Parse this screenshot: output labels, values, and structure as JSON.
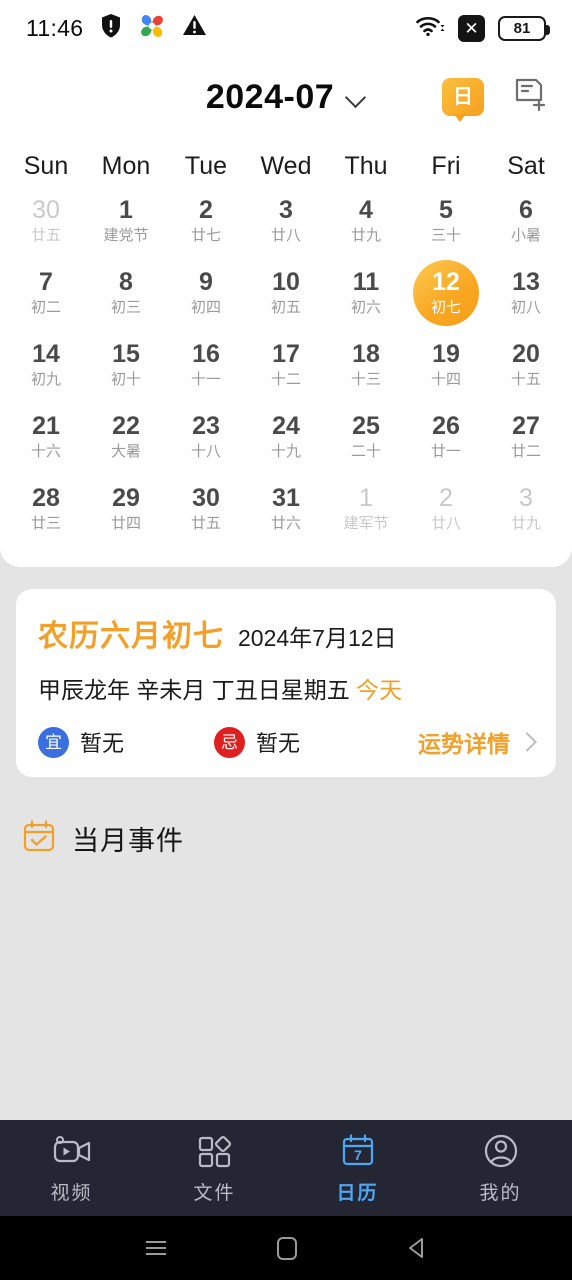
{
  "statusbar": {
    "time": "11:46",
    "icons_left": [
      "shield-exclamation-icon",
      "pinwheel-icon",
      "warning-triangle-icon"
    ],
    "icons_right": [
      "wifi-icon",
      "no-sim-icon"
    ],
    "no_sim_glyph": "✕",
    "battery_level": "81"
  },
  "header": {
    "title": "2024-07",
    "dropdown_icon": "chevron-down-icon",
    "today_button_label": "日",
    "add_event_icon": "add-note-icon"
  },
  "calendar": {
    "weekdays": [
      "Sun",
      "Mon",
      "Tue",
      "Wed",
      "Thu",
      "Fri",
      "Sat"
    ],
    "days": [
      {
        "num": "30",
        "lunar": "廿五",
        "other": true,
        "today": false
      },
      {
        "num": "1",
        "lunar": "建党节",
        "other": false,
        "today": false
      },
      {
        "num": "2",
        "lunar": "廿七",
        "other": false,
        "today": false
      },
      {
        "num": "3",
        "lunar": "廿八",
        "other": false,
        "today": false
      },
      {
        "num": "4",
        "lunar": "廿九",
        "other": false,
        "today": false
      },
      {
        "num": "5",
        "lunar": "三十",
        "other": false,
        "today": false
      },
      {
        "num": "6",
        "lunar": "小暑",
        "other": false,
        "today": false
      },
      {
        "num": "7",
        "lunar": "初二",
        "other": false,
        "today": false
      },
      {
        "num": "8",
        "lunar": "初三",
        "other": false,
        "today": false
      },
      {
        "num": "9",
        "lunar": "初四",
        "other": false,
        "today": false
      },
      {
        "num": "10",
        "lunar": "初五",
        "other": false,
        "today": false
      },
      {
        "num": "11",
        "lunar": "初六",
        "other": false,
        "today": false
      },
      {
        "num": "12",
        "lunar": "初七",
        "other": false,
        "today": true
      },
      {
        "num": "13",
        "lunar": "初八",
        "other": false,
        "today": false
      },
      {
        "num": "14",
        "lunar": "初九",
        "other": false,
        "today": false
      },
      {
        "num": "15",
        "lunar": "初十",
        "other": false,
        "today": false
      },
      {
        "num": "16",
        "lunar": "十一",
        "other": false,
        "today": false
      },
      {
        "num": "17",
        "lunar": "十二",
        "other": false,
        "today": false
      },
      {
        "num": "18",
        "lunar": "十三",
        "other": false,
        "today": false
      },
      {
        "num": "19",
        "lunar": "十四",
        "other": false,
        "today": false
      },
      {
        "num": "20",
        "lunar": "十五",
        "other": false,
        "today": false
      },
      {
        "num": "21",
        "lunar": "十六",
        "other": false,
        "today": false
      },
      {
        "num": "22",
        "lunar": "大暑",
        "other": false,
        "today": false
      },
      {
        "num": "23",
        "lunar": "十八",
        "other": false,
        "today": false
      },
      {
        "num": "24",
        "lunar": "十九",
        "other": false,
        "today": false
      },
      {
        "num": "25",
        "lunar": "二十",
        "other": false,
        "today": false
      },
      {
        "num": "26",
        "lunar": "廿一",
        "other": false,
        "today": false
      },
      {
        "num": "27",
        "lunar": "廿二",
        "other": false,
        "today": false
      },
      {
        "num": "28",
        "lunar": "廿三",
        "other": false,
        "today": false
      },
      {
        "num": "29",
        "lunar": "廿四",
        "other": false,
        "today": false
      },
      {
        "num": "30",
        "lunar": "廿五",
        "other": false,
        "today": false
      },
      {
        "num": "31",
        "lunar": "廿六",
        "other": false,
        "today": false
      },
      {
        "num": "1",
        "lunar": "建军节",
        "other": true,
        "today": false
      },
      {
        "num": "2",
        "lunar": "廿八",
        "other": true,
        "today": false
      },
      {
        "num": "3",
        "lunar": "廿九",
        "other": true,
        "today": false
      }
    ]
  },
  "detail": {
    "lunar_title": "农历六月初七",
    "gregorian_date": "2024年7月12日",
    "ganzhi": "甲辰龙年 辛未月 丁丑日星期五",
    "today_tag": "今天",
    "yi_label": "宜",
    "yi_value": "暂无",
    "ji_label": "忌",
    "ji_value": "暂无",
    "fortune_link": "运势详情",
    "fortune_chevron": "chevron-right-icon",
    "accent_color": "#F2A02A",
    "yi_color": "#3B6FE0",
    "ji_color": "#E02020"
  },
  "events": {
    "icon": "calendar-check-icon",
    "title": "当月事件"
  },
  "bottomnav": {
    "items": [
      {
        "label": "视频",
        "icon": "video-camera-icon",
        "active": false
      },
      {
        "label": "文件",
        "icon": "grid-files-icon",
        "active": false
      },
      {
        "label": "日历",
        "icon": "calendar-icon",
        "active": true,
        "badge": "7"
      },
      {
        "label": "我的",
        "icon": "user-profile-icon",
        "active": false
      }
    ],
    "active_color": "#4FA8F5",
    "inactive_color": "#B9BCC6"
  },
  "androidnav": {
    "buttons": [
      "recents-icon",
      "home-icon",
      "back-icon"
    ]
  }
}
